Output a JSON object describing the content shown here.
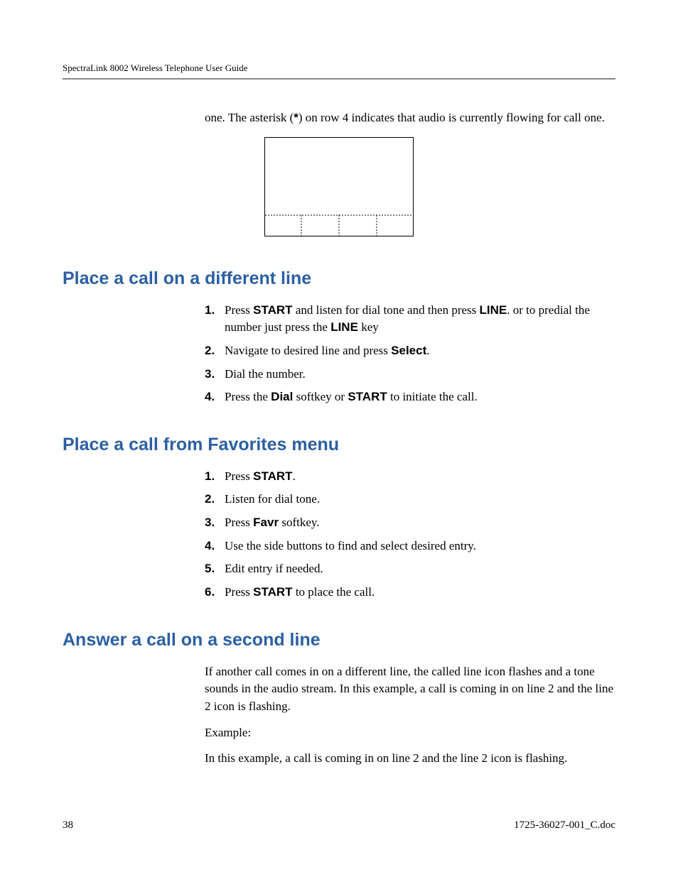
{
  "header": {
    "title": "SpectraLink 8002 Wireless Telephone User Guide"
  },
  "intro_fragment": {
    "text_before_ast": "one. The asterisk (",
    "asterisk": "*",
    "text_after_ast": ") on row 4 indicates that audio is currently flowing for call one."
  },
  "section1": {
    "heading": "Place a call on a different line",
    "steps": [
      {
        "pre": "Press ",
        "b1": "START",
        "mid1": " and listen for dial tone and then press ",
        "b2": "LINE",
        "mid2": ". or to predial the number just press the ",
        "b3": "LINE",
        "tail": " key"
      },
      {
        "pre": "Navigate to desired line and press ",
        "b1": "Select",
        "tail": "."
      },
      {
        "pre": "Dial the number."
      },
      {
        "pre": "Press the ",
        "b1": "Dial",
        "mid1": " softkey or ",
        "b2": "START",
        "tail": " to initiate the call."
      }
    ]
  },
  "section2": {
    "heading": "Place a call from Favorites menu",
    "steps": [
      {
        "pre": "Press ",
        "b1": "START",
        "tail": "."
      },
      {
        "pre": "Listen for dial tone."
      },
      {
        "pre": "Press ",
        "b1": "Favr",
        "tail": " softkey."
      },
      {
        "pre": "Use the side buttons to find and select desired entry."
      },
      {
        "pre": "Edit entry if needed."
      },
      {
        "pre": "Press ",
        "b1": "START",
        "tail": " to place the call."
      }
    ]
  },
  "section3": {
    "heading": "Answer a call on a second line",
    "para1": "If another call comes in on a different line, the called line icon flashes and a tone sounds in the audio stream. In this example, a call is coming in on line 2 and the line 2 icon is flashing.",
    "example_label": "Example:",
    "para2": "In this example, a call is coming in on line 2 and the line 2 icon is flashing."
  },
  "footer": {
    "page_number": "38",
    "doc_ref": "1725-36027-001_C.doc"
  }
}
